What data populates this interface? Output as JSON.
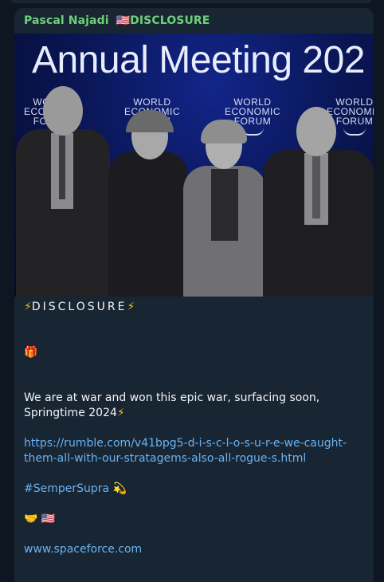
{
  "message": {
    "sender_name": "Pascal Najadi",
    "sender_flag": "🇺🇸",
    "sender_tag": "DISCLOSURE",
    "photo": {
      "headline": "Annual Meeting 202",
      "logo_text": [
        "WORLD",
        "ECONOMIC",
        "FORUM"
      ]
    },
    "title_bolt_left": "⚡",
    "title": "DISCLOSURE",
    "title_bolt_right": "⚡",
    "gift_emoji": "🎁",
    "text_line1": "We are at war and won this epic war, surfacing soon,",
    "text_line2": "Springtime 2024",
    "text_line2_bolt": "⚡",
    "link_line1": "https://rumble.com/v41bpg5-d-i-s-c-l-o-s-u-r-e-we-caught-",
    "link_line2": "them-all-with-our-stratagems-also-all-rogue-s.html",
    "hashtag": "#SemperSupra",
    "hashtag_emoji": "💫",
    "handshake_emoji": "🤝",
    "flag_emoji": "🇺🇸",
    "website": "www.spaceforce.com"
  },
  "colors": {
    "background": "#0e1621",
    "bubble": "#182533",
    "sender": "#6fd07b",
    "link": "#6ab3f3",
    "text": "#f5f5f5"
  }
}
